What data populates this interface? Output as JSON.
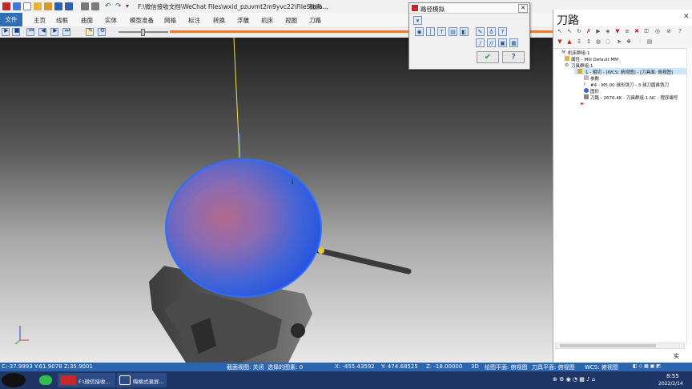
{
  "title_bar": {
    "file_path": "F:\\微信接收文档\\WeChat Files\\wxid_pzuvmt2m9yvc22\\FileStora...",
    "context_tab": "铣床"
  },
  "ribbon": {
    "file_tab": "文件",
    "tabs": [
      "主页",
      "线框",
      "曲面",
      "实体",
      "模型准备",
      "网格",
      "标注",
      "转换",
      "浮雕",
      "机床",
      "视图",
      "刀路"
    ]
  },
  "sim_dialog": {
    "title": "路径模拟"
  },
  "panel": {
    "title": "刀路",
    "tree": [
      "机床群组-1",
      "属性 - Mill Default MM",
      "刀具群组-1",
      "1 - 粗切 - [WCS: 俯视图] - [刀具面: 俯视图]",
      "参数",
      "#4 - M5.00 球形铣刀 - 3 球刀圆鼻铣刀",
      "图形",
      "刀路 - 2676.4K - 刀具群组-1.NC - 程序编号"
    ]
  },
  "status_bar": {
    "coords": "C:-37.9993  Y:61.9078  Z:35.9001",
    "section_view": "截面视图: 关闭",
    "selected": "选择的图素: 0",
    "x": "X:   -455.43592",
    "y": "Y:   474.68525",
    "z": "Z:   -18.00000",
    "mode": "3D",
    "draw_plane": "绘图平面: 俯视图",
    "tool_plane": "刀具平面: 俯视图",
    "wcs": "WCS: 俯视图"
  },
  "taskbar": {
    "app1_label": "F:\\微信接收...",
    "app2_label": "嗨格式录屏...",
    "clock_time": "8:55",
    "clock_date": "2022/2/14"
  },
  "panel_bottom_label": "实",
  "colors": {
    "accent_blue": "#2b65b0",
    "orange_bar": "#f07b22",
    "toolpath_blue": "#2f6fff"
  }
}
